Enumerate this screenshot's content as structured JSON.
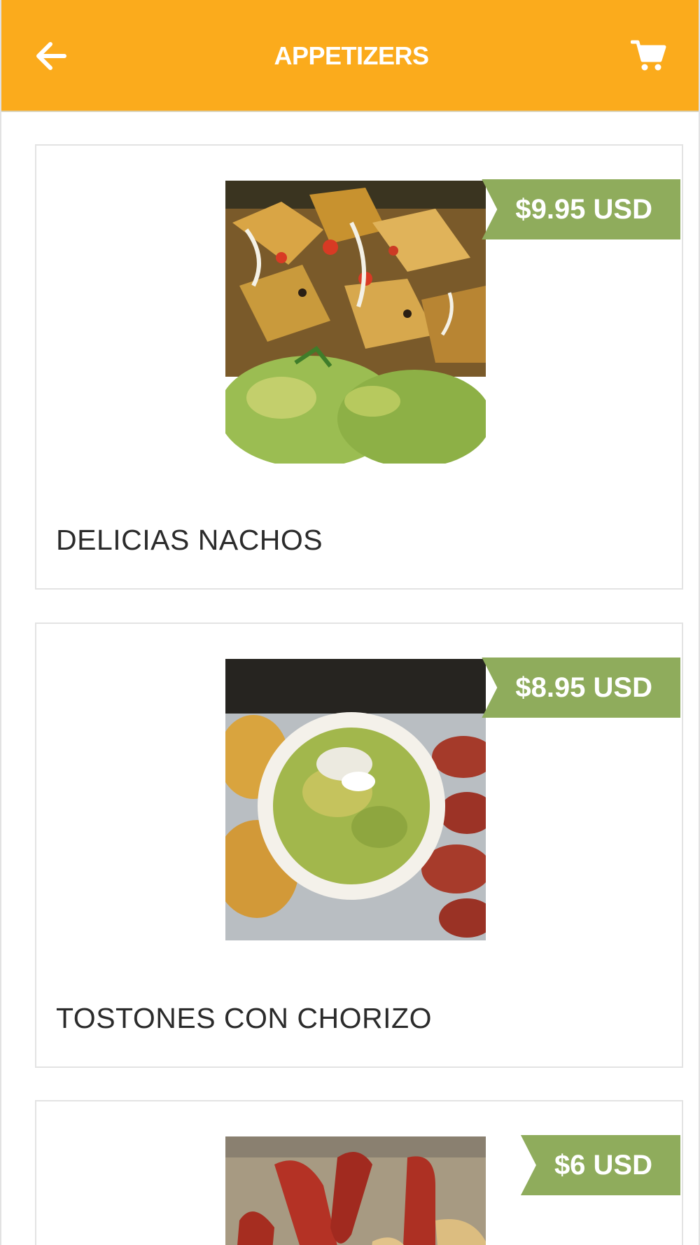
{
  "header": {
    "title": "APPETIZERS",
    "back_icon": "arrow-left-icon",
    "cart_icon": "shopping-cart-icon",
    "background_color": "#fbab1c"
  },
  "items": [
    {
      "name": "DELICIAS NACHOS",
      "price": "$9.95 USD"
    },
    {
      "name": "TOSTONES CON CHORIZO",
      "price": "$8.95 USD"
    },
    {
      "name": "",
      "price": "$6 USD"
    }
  ],
  "colors": {
    "price_tag": "#8fac5c",
    "card_border": "#e3e3e3",
    "title_text": "#ffffff",
    "item_text": "#2b2b2b"
  }
}
